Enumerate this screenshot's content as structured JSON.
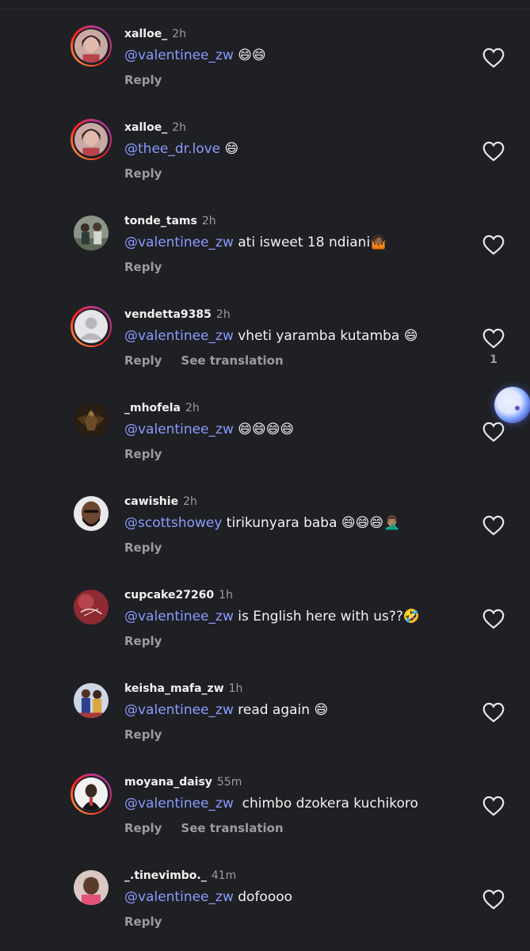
{
  "comments": [
    {
      "username": "xalloe_",
      "time": "2h",
      "mention": "@valentinee_zw",
      "text": " 😄😄",
      "reply_label": "Reply",
      "translate_label": "",
      "like_count": "",
      "has_story": true,
      "avatar": "woman-selfie-avatar"
    },
    {
      "username": "xalloe_",
      "time": "2h",
      "mention": "@thee_dr.love",
      "text": " 😄",
      "reply_label": "Reply",
      "translate_label": "",
      "like_count": "",
      "has_story": true,
      "avatar": "woman-selfie-avatar"
    },
    {
      "username": "tonde_tams",
      "time": "2h",
      "mention": "@valentinee_zw",
      "text": " ati isweet 18 ndiani🤷🏾",
      "reply_label": "Reply",
      "translate_label": "",
      "like_count": "",
      "has_story": false,
      "avatar": "group-photo-avatar"
    },
    {
      "username": "vendetta9385",
      "time": "2h",
      "mention": "@valentinee_zw",
      "text": " vheti yaramba kutamba 😄",
      "reply_label": "Reply",
      "translate_label": "See translation",
      "like_count": "1",
      "has_story": true,
      "avatar": "default-user-avatar"
    },
    {
      "username": "_mhofela",
      "time": "2h",
      "mention": "@valentinee_zw",
      "text": " 😄😄😄😄",
      "reply_label": "Reply",
      "translate_label": "",
      "like_count": "",
      "has_story": false,
      "avatar": "dark-eagle-avatar"
    },
    {
      "username": "cawishie",
      "time": "2h",
      "mention": "@scottshowey",
      "text": " tirikunyara baba 😄😄😄🤦🏽‍♂️",
      "reply_label": "Reply",
      "translate_label": "",
      "like_count": "",
      "has_story": false,
      "avatar": "bald-man-avatar"
    },
    {
      "username": "cupcake27260",
      "time": "1h",
      "mention": "@valentinee_zw",
      "text": " is English here with us??🤣",
      "reply_label": "Reply",
      "translate_label": "",
      "like_count": "",
      "has_story": false,
      "avatar": "red-artwork-avatar"
    },
    {
      "username": "keisha_mafa_zw",
      "time": "1h",
      "mention": "@valentinee_zw",
      "text": " read again 😄",
      "reply_label": "Reply",
      "translate_label": "",
      "like_count": "",
      "has_story": false,
      "avatar": "couple-photo-avatar"
    },
    {
      "username": "moyana_daisy",
      "time": "55m",
      "mention": "@valentinee_zw",
      "text": "  chimbo dzokera kuchikoro",
      "reply_label": "Reply",
      "translate_label": "See translation",
      "like_count": "",
      "has_story": true,
      "avatar": "man-portrait-avatar"
    },
    {
      "username": "_.tinevimbo._",
      "time": "41m",
      "mention": "@valentinee_zw",
      "text": " dofoooo",
      "reply_label": "Reply",
      "translate_label": "",
      "like_count": "",
      "has_story": false,
      "avatar": "smiling-woman-avatar"
    }
  ],
  "colors": {
    "background": "#1f2024",
    "mention": "#8a9bff",
    "secondary_text": "#9a9ca1"
  }
}
